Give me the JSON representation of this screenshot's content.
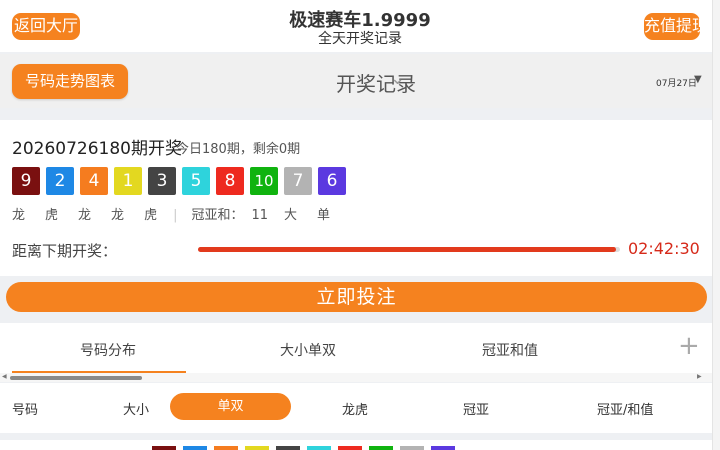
{
  "header": {
    "left_button": "返回大厅",
    "title": "极速赛车1.9999",
    "subtitle": "全天开奖记录",
    "right_button": "充值提现"
  },
  "subheader": {
    "button": "号码走势图表",
    "center_title": "开奖记录",
    "date": "07月27日"
  },
  "draw": {
    "title": "20260726180期开奖",
    "info": "今日180期，剩余0期",
    "balls": [
      {
        "num": "9",
        "color": "#7a1010"
      },
      {
        "num": "2",
        "color": "#1e88e5"
      },
      {
        "num": "4",
        "color": "#f57c1f"
      },
      {
        "num": "1",
        "color": "#e3d820"
      },
      {
        "num": "3",
        "color": "#444444"
      },
      {
        "num": "5",
        "color": "#2ed3dc"
      },
      {
        "num": "8",
        "color": "#ee2a1f"
      },
      {
        "num": "10",
        "color": "#10b30f"
      },
      {
        "num": "7",
        "color": "#b3b3b3"
      },
      {
        "num": "6",
        "color": "#5b39e0"
      }
    ],
    "attrs": [
      "龙",
      "虎",
      "龙",
      "龙",
      "虎",
      "|",
      "冠亚和：",
      "11",
      "大",
      "单"
    ],
    "countdown_label": "距离下期开奖：",
    "countdown_progress": 0.99,
    "countdown_time": "02:42:30"
  },
  "big_button": "立即投注",
  "tabs": [
    "号码分布",
    "大小单双",
    "冠亚和值"
  ],
  "filters": [
    "号码",
    "大小",
    "单双",
    "龙虎",
    "冠亚",
    "冠亚/和值"
  ],
  "active_filter": "单双",
  "bottom_colors": [
    "#7a1010",
    "#1e88e5",
    "#f57c1f",
    "#e3d820",
    "#444444",
    "#2ed3dc",
    "#ee2a1f",
    "#10b30f",
    "#b3b3b3",
    "#5b39e0"
  ]
}
